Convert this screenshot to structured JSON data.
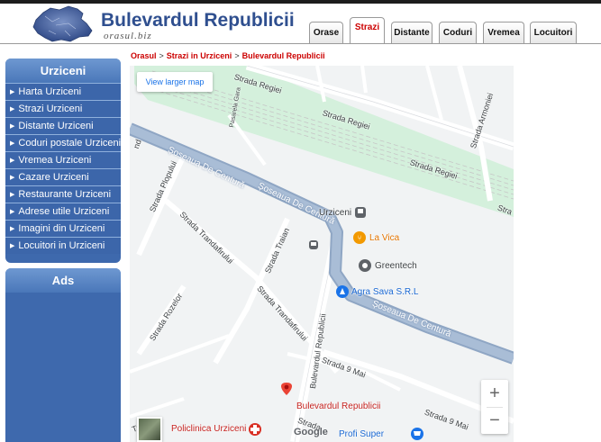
{
  "header": {
    "site_title": "Bulevardul Republicii",
    "site_domain": "orasul.biz",
    "tabs": [
      {
        "label": "Orase",
        "active": false
      },
      {
        "label": "Strazi",
        "active": true
      },
      {
        "label": "Distante",
        "active": false
      },
      {
        "label": "Coduri",
        "active": false
      },
      {
        "label": "Vremea",
        "active": false
      },
      {
        "label": "Locuitori",
        "active": false
      }
    ]
  },
  "sidebar": {
    "city_title": "Urziceni",
    "items": [
      {
        "label": "Harta Urziceni"
      },
      {
        "label": "Strazi Urziceni"
      },
      {
        "label": "Distante Urziceni"
      },
      {
        "label": "Coduri postale Urziceni"
      },
      {
        "label": "Vremea Urziceni"
      },
      {
        "label": "Cazare Urziceni"
      },
      {
        "label": "Restaurante Urziceni"
      },
      {
        "label": "Adrese utile Urziceni"
      },
      {
        "label": "Imagini din Urziceni"
      },
      {
        "label": "Locuitori in Urziceni"
      }
    ],
    "ads_title": "Ads"
  },
  "breadcrumb": {
    "items": [
      "Orasul",
      "Strazi in Urziceni",
      "Bulevardul Republicii"
    ],
    "separator": ">"
  },
  "map": {
    "view_larger": "View larger map",
    "streets": {
      "regiei_1": "Strada Regiei",
      "regiei_2": "Strada Regiei",
      "regiei_3": "Strada Regiei",
      "armoniei": "Strada Armoniei",
      "str_right": "Stra",
      "plopului": "Strada Plopului",
      "pasarela": "Pasarela Gara",
      "centura_1": "Șoseaua De Centură",
      "centura_2": "Șoseaua De Centură",
      "centura_3": "Șoseaua De Centură",
      "trandafirului_1": "Strada Trandafirului",
      "trandafirului_2": "Strada Trandafirului",
      "traian": "Strada Traian",
      "rozelor": "Strada Rozelor",
      "bulevardul": "Bulevardul Republicii",
      "mai_1": "Strada 9 Mai",
      "mai_2": "Strada 9 Mai",
      "traian_2": "Traian",
      "strada_bottom": "Strada",
      "nd": "nd"
    },
    "places": {
      "urziceni": "Urziceni",
      "la_vica": "La Vica",
      "greentech": "Greentech",
      "agra_sava": "Agra Sava S.R.L",
      "pin_label": "Bulevardul Republicii",
      "policlinica": "Policlinica Urziceni",
      "profi": "Profi Super"
    },
    "zoom_in": "+",
    "zoom_out": "−",
    "google": "Google",
    "colors": {
      "pin": "#ea4335",
      "restaurant": "#f29900",
      "shopping": "#1a73e8",
      "medical": "#d93025",
      "rail_area": "#d4f0dc",
      "highway": "#8fa6c4"
    }
  }
}
